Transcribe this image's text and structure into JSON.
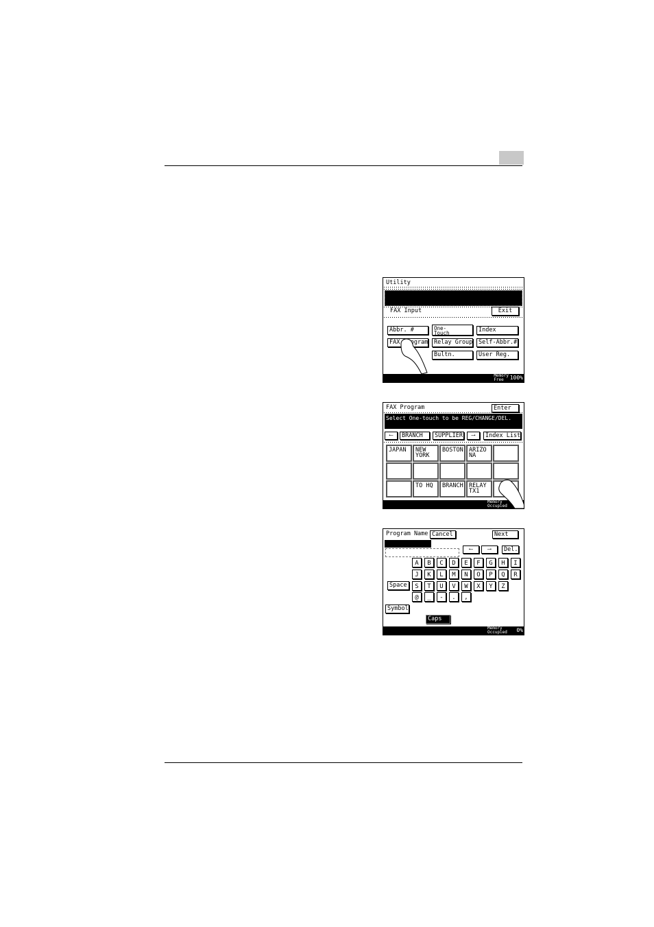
{
  "screen1": {
    "title": "Utility",
    "subtitle": "FAX Input",
    "exit": "Exit",
    "buttons": [
      "Abbr. #",
      "One-\nTouch",
      "Index",
      "FAX Program",
      "Relay Group",
      "Self-Abbr.#",
      "Bultn.",
      "User Reg."
    ],
    "memory_label": "Memory\nFree",
    "memory_value": "100%"
  },
  "screen2": {
    "title": "FAX Program",
    "enter": "Enter",
    "message": "Select One-touch to be REG/CHANGE/DEL.",
    "tabs": [
      "BRANCH",
      "SUPPLIER"
    ],
    "index_list": "Index List",
    "cells": [
      "JAPAN",
      "NEW\nYORK",
      "BOSTON",
      "ARIZO\nNA",
      "",
      "",
      "",
      "",
      "",
      "",
      "",
      "TO HQ",
      "BRANCH",
      "RELAY\nTX1",
      ""
    ],
    "memory_label": "Memory\nOccupied"
  },
  "screen3": {
    "title": "Program Name",
    "cancel": "Cancel",
    "next": "Next",
    "del": "Del.",
    "row1": [
      "A",
      "B",
      "C",
      "D",
      "E",
      "F",
      "G",
      "H",
      "I"
    ],
    "row2": [
      "J",
      "K",
      "L",
      "M",
      "N",
      "O",
      "P",
      "Q",
      "R"
    ],
    "row3": [
      "S",
      "T",
      "U",
      "V",
      "W",
      "X",
      "Y",
      "Z"
    ],
    "row4": [
      "@",
      "_",
      "-",
      ".",
      ","
    ],
    "space": "Space",
    "symbol": "Symbol",
    "caps": "Caps",
    "memory_label": "Memory\nOccupied",
    "memory_value": "0%"
  }
}
